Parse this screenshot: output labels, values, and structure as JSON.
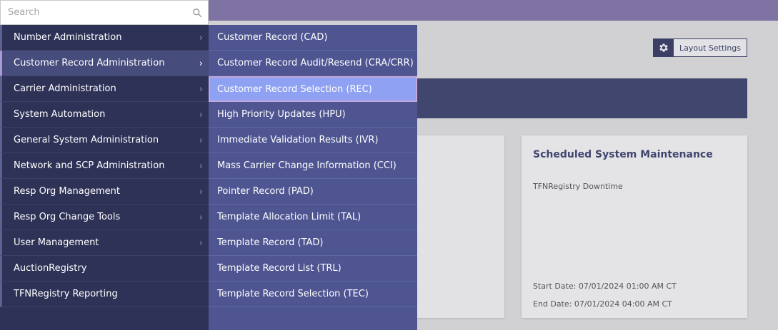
{
  "search": {
    "placeholder": "Search"
  },
  "layout_settings": {
    "label": "Layout Settings"
  },
  "menu": {
    "items": [
      {
        "label": "Number Administration",
        "chevron": true
      },
      {
        "label": "Customer Record Administration",
        "chevron": true,
        "active": true
      },
      {
        "label": "Carrier Administration",
        "chevron": true
      },
      {
        "label": "System Automation",
        "chevron": true
      },
      {
        "label": "General System Administration",
        "chevron": true
      },
      {
        "label": "Network and SCP Administration",
        "chevron": true
      },
      {
        "label": "Resp Org Management",
        "chevron": true
      },
      {
        "label": "Resp Org Change Tools",
        "chevron": true
      },
      {
        "label": "User Management",
        "chevron": true
      },
      {
        "label": "AuctionRegistry",
        "chevron": false
      },
      {
        "label": "TFNRegistry Reporting",
        "chevron": false
      }
    ]
  },
  "submenu": {
    "items": [
      {
        "label": "Customer Record (CAD)"
      },
      {
        "label": "Customer Record Audit/Resend (CRA/CRR)"
      },
      {
        "label": "Customer Record Selection (REC)",
        "active": true
      },
      {
        "label": "High Priority Updates (HPU)"
      },
      {
        "label": "Immediate Validation Results (IVR)"
      },
      {
        "label": "Mass Carrier Change Information (CCI)"
      },
      {
        "label": "Pointer Record (PAD)"
      },
      {
        "label": "Template Allocation Limit (TAL)"
      },
      {
        "label": "Template Record (TAD)"
      },
      {
        "label": "Template Record List (TRL)"
      },
      {
        "label": "Template Record Selection (TEC)"
      }
    ]
  },
  "maintenance_card": {
    "title": "Scheduled System Maintenance",
    "subtitle": "TFNRegistry Downtime",
    "start": "Start Date: 07/01/2024 01:00 AM CT",
    "end": "End Date:  07/01/2024 04:00 AM CT"
  },
  "icons": {
    "search": "search-icon",
    "settings": "gear-icon",
    "chevron": "chevron-right-icon"
  }
}
